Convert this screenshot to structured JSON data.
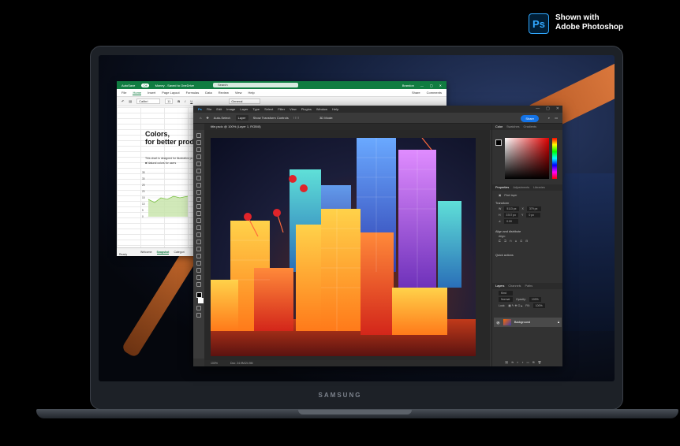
{
  "badge": {
    "line1": "Shown with",
    "line2": "Adobe Photoshop",
    "logo": "Ps"
  },
  "laptop": {
    "brand": "SAMSUNG"
  },
  "excel": {
    "autosave": "AutoSave",
    "autosave_state": "Off",
    "doc_title": "Money - Saved to OneDrive",
    "search_placeholder": "Search",
    "user": "Brandon",
    "tabs": [
      "File",
      "Home",
      "Insert",
      "Page Layout",
      "Formulas",
      "Data",
      "Review",
      "View",
      "Help"
    ],
    "share": "Share",
    "comments": "Comments",
    "font": "Calibri",
    "font_size": "11",
    "number_format": "General",
    "heading_line1": "Colors,",
    "heading_line2": "for better produ",
    "desc": "This chart is designed for illustrative pu",
    "legend": "Natural colors for users",
    "chart_y_ticks": [
      "35",
      "30",
      "25",
      "20",
      "15",
      "10",
      "5",
      "0"
    ],
    "sheets": [
      "Welcome",
      "Snapshot",
      "Categori"
    ],
    "status": "Ready"
  },
  "photoshop": {
    "menu": [
      "Ps",
      "File",
      "Edit",
      "Image",
      "Layer",
      "Type",
      "Select",
      "Filter",
      "View",
      "Plugins",
      "Window",
      "Help"
    ],
    "options": {
      "auto_select": "Auto-Select:",
      "layer": "Layer",
      "transform": "Show Transform Controls",
      "mode3d": "3D Mode:"
    },
    "share": "Share",
    "doc_tab": "title.psdc @ 100% (Layer 1, RGB/8)",
    "status_zoom": "100%",
    "status_doc": "Doc: 24.9M/24.9M",
    "color_tabs": [
      "Color",
      "Swatches",
      "Gradients"
    ],
    "prop_tabs": [
      "Properties",
      "Adjustments",
      "Libraries"
    ],
    "pixel_layer": "Pixel layer",
    "transform": "Transform",
    "w_label": "W",
    "w_value": "5113 px",
    "h_label": "H",
    "h_value": "3747 px",
    "x_label": "X",
    "x_value": "379 px",
    "y_label": "Y",
    "y_value": "0 px",
    "angle": "0.00",
    "align": "Align and distribute",
    "align_sub": "Align:",
    "quick_actions": "Quick actions",
    "layer_tabs": [
      "Layers",
      "Channels",
      "Paths"
    ],
    "kind": "Kind",
    "blend": "Normal",
    "opacity_label": "Opacity:",
    "opacity": "100%",
    "lock_label": "Lock:",
    "fill_label": "Fill:",
    "fill": "100%",
    "layer_name": "Background"
  },
  "colors": {
    "excel_green": "#107c41",
    "ps_blue": "#1473e6",
    "ps_bg": "#323232"
  }
}
